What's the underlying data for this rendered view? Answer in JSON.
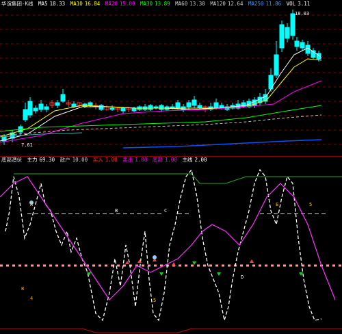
{
  "main": {
    "title": "华谊集团-K线",
    "ma5_label": "MA5",
    "ma5_value": "18.33",
    "ma10_label": "MA10",
    "ma10_value": "16.84",
    "ma20_label": "MA20",
    "ma20_value": "15.00",
    "ma30_label": "MA30",
    "ma30_value": "13.89",
    "ma60_label": "MA60",
    "ma60_value": "13.30",
    "ma120_label": "MA120",
    "ma120_value": "12.64",
    "ma250_label": "MA250",
    "ma250_value": "11.86",
    "extra_label": "VOL",
    "extra_value": "3.11",
    "high_price": "18.03",
    "low_price": "7.61",
    "colors": {
      "ma5": "#ffffff",
      "ma10": "#ffff00",
      "ma20": "#ff00ff",
      "ma30": "#00ff00",
      "ma60": "#c0c0c0",
      "ma120": "#0055ff",
      "up": "#ff3b3b",
      "down": "#00ffff"
    }
  },
  "indicator": {
    "title": "底部潜伏",
    "line1_label": "主力",
    "line1_value": "69.30",
    "line2_label": "散户",
    "line2_value": "10.00",
    "line3_label": "买入",
    "line3_value": "1.00",
    "line4_label": "卖出",
    "line4_value": "1.00",
    "line5_label": "底部",
    "line5_value": "1.00",
    "line6_label": "主线",
    "line6_value": "2.00",
    "marks": {
      "a": "A",
      "b": "B",
      "c": "C",
      "d": "D",
      "e": "E",
      "f": "5",
      "g": "4",
      "h": "5",
      "i": "B"
    },
    "colors": {
      "white_line": "#ffffff",
      "magenta_line": "#ff33ff",
      "top_line": "#22aa22",
      "threshold": "#ff9999",
      "bottom_line": "#cc0000"
    }
  }
}
